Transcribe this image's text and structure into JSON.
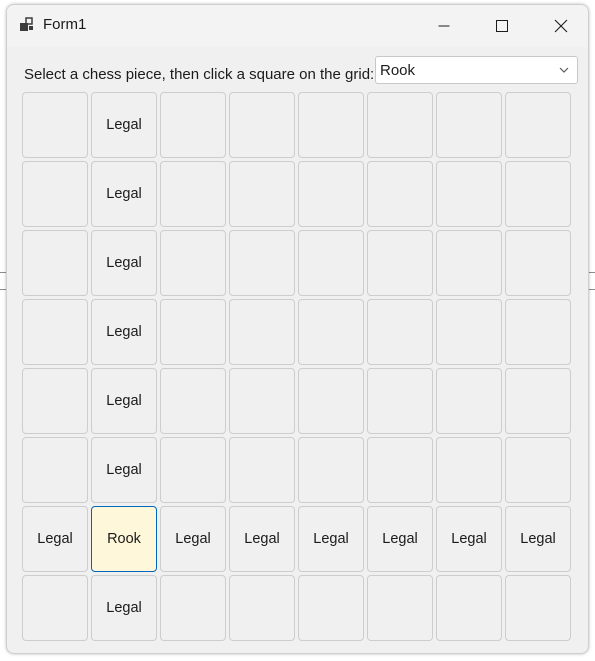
{
  "window": {
    "title": "Form1"
  },
  "instruction": "Select a chess piece, then click a square on the grid:",
  "piece_select": {
    "value": "Rook"
  },
  "board": {
    "rows": [
      [
        "",
        "Legal",
        "",
        "",
        "",
        "",
        "",
        ""
      ],
      [
        "",
        "Legal",
        "",
        "",
        "",
        "",
        "",
        ""
      ],
      [
        "",
        "Legal",
        "",
        "",
        "",
        "",
        "",
        ""
      ],
      [
        "",
        "Legal",
        "",
        "",
        "",
        "",
        "",
        ""
      ],
      [
        "",
        "Legal",
        "",
        "",
        "",
        "",
        "",
        ""
      ],
      [
        "",
        "Legal",
        "",
        "",
        "",
        "",
        "",
        ""
      ],
      [
        "Legal",
        "Rook",
        "Legal",
        "Legal",
        "Legal",
        "Legal",
        "Legal",
        "Legal"
      ],
      [
        "",
        "Legal",
        "",
        "",
        "",
        "",
        "",
        ""
      ]
    ],
    "selected": {
      "row": 6,
      "col": 1
    }
  },
  "colors": {
    "selected_fill": "#fff7da",
    "selected_border": "#0067c0",
    "cell_fill": "#f0f0f0"
  }
}
